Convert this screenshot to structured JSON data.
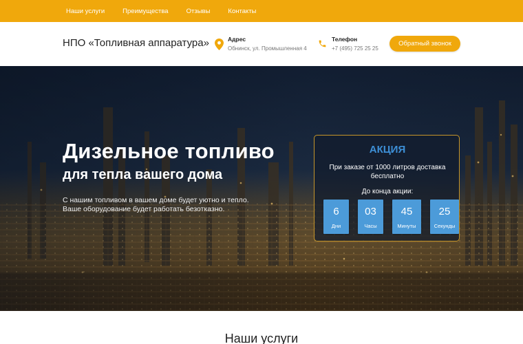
{
  "nav": {
    "items": [
      "Наши услуги",
      "Преимущества",
      "Отзывы",
      "Контакты"
    ]
  },
  "header": {
    "brand": "НПО «Топливная аппаратура»",
    "address_label": "Адрес",
    "address_value": "Обнинск, ул. Промышленная 4",
    "phone_label": "Телефон",
    "phone_value": "+7 (495) 725 25 25",
    "callback_button": "Обратный звонок",
    "icons": [
      "map-pin-icon",
      "phone-icon"
    ]
  },
  "hero": {
    "title": "Дизельное топливо",
    "subtitle": "для тепла вашего дома",
    "description": "С нашим топливом в вашем доме будет уютно и тепло. Ваше оборудование будет работать безотказно."
  },
  "promo": {
    "title": "АКЦИЯ",
    "text": "При заказе от 1000 литров доставка бесплатно",
    "until": "До конца акции:",
    "countdown": [
      {
        "value": "6",
        "unit": "Дни"
      },
      {
        "value": "03",
        "unit": "Часы"
      },
      {
        "value": "45",
        "unit": "Минуты"
      },
      {
        "value": "25",
        "unit": "Секунды"
      }
    ]
  },
  "services": {
    "title": "Наши услуги"
  },
  "colors": {
    "accent": "#f0a80c",
    "promo_title": "#3d8fd6",
    "tile": "#4c9bd9"
  }
}
